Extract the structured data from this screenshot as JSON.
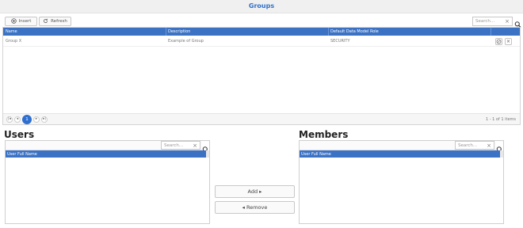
{
  "header": {
    "title": "Groups"
  },
  "toolbar": {
    "insert_label": "Insert",
    "refresh_label": "Refresh",
    "search_placeholder": "Search..."
  },
  "grid": {
    "columns": [
      "Name",
      "Description",
      "Default Data Model Role"
    ],
    "rows": [
      {
        "name": "Group X",
        "description": "Example of Group",
        "role": "SECURITY"
      }
    ],
    "pager": {
      "current_page": "1",
      "info": "1 - 1 of 1 items"
    }
  },
  "users": {
    "title": "Users",
    "search_placeholder": "Search...",
    "column": "User Full Name"
  },
  "members": {
    "title": "Members",
    "search_placeholder": "Search...",
    "column": "User Full Name"
  },
  "actions": {
    "add_label": "Add ▸",
    "remove_label": "◂ Remove"
  },
  "colors": {
    "accent": "#3b72c4",
    "title": "#3271c8",
    "active_page": "#2f6fcf"
  }
}
